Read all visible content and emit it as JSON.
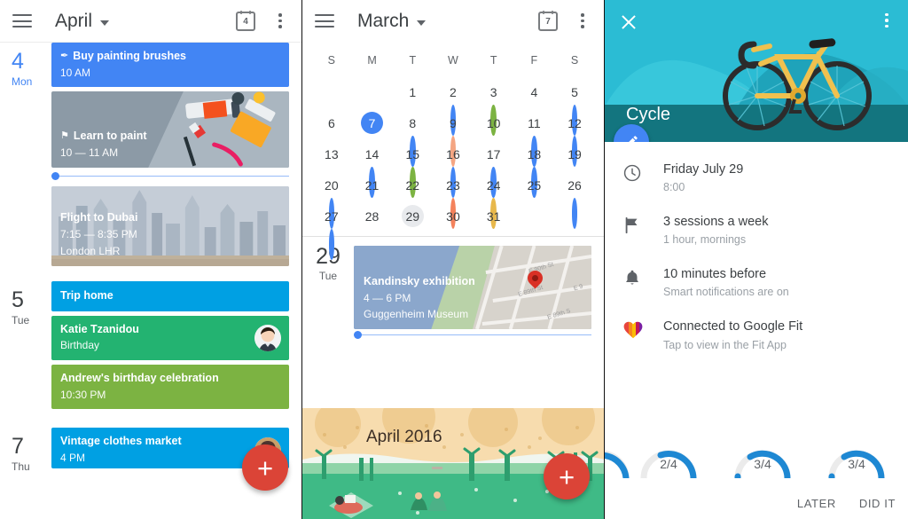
{
  "schedule_panel": {
    "toolbar": {
      "menu_icon": "hamburger-menu-icon",
      "title": "April",
      "dropdown_icon": "caret-down-icon",
      "calendar_icon_label": "4",
      "overflow_icon": "more-vertical-icon"
    },
    "days": [
      {
        "num": "4",
        "dow": "Mon",
        "is_today": true,
        "events": [
          {
            "title": "Buy painting brushes",
            "sub": "10 AM",
            "color": "#4285f4",
            "glyph": "✎",
            "style": "blue"
          },
          {
            "title": "Learn to paint",
            "sub": "10 — 11 AM",
            "glyph": "⚑",
            "style": "paint-image"
          },
          {
            "title": "Flight to Dubai",
            "sub": "7:15 — 8:35 PM",
            "sub2": "London LHR",
            "style": "dubai-image"
          }
        ]
      },
      {
        "num": "5",
        "dow": "Tue",
        "is_today": false,
        "events": [
          {
            "title": "Trip home",
            "sub": "",
            "color": "#00a0e3",
            "style": "lblue"
          },
          {
            "title": "Katie Tzanidou",
            "sub": "Birthday",
            "color": "#23b371",
            "style": "green",
            "avatar": true
          },
          {
            "title": "Andrew's birthday celebration",
            "sub": "10:30 PM",
            "color": "#7cb342",
            "style": "ltgreen"
          }
        ]
      },
      {
        "num": "7",
        "dow": "Thu",
        "is_today": false,
        "events": [
          {
            "title": "Vintage clothes market",
            "sub": "4 PM",
            "color": "#00a0e3",
            "style": "lblue",
            "avatar": true
          }
        ]
      }
    ],
    "fab": {
      "icon": "plus-icon",
      "color": "#db4437"
    }
  },
  "month_panel": {
    "toolbar": {
      "menu_icon": "hamburger-menu-icon",
      "title": "March",
      "dropdown_icon": "caret-down-icon",
      "calendar_icon_label": "7",
      "overflow_icon": "more-vertical-icon"
    },
    "dow_headers": [
      "S",
      "M",
      "T",
      "W",
      "T",
      "F",
      "S"
    ],
    "weeks": [
      [
        {
          "n": ""
        },
        {
          "n": ""
        },
        {
          "n": "1"
        },
        {
          "n": "2",
          "dot": "#4285f4"
        },
        {
          "n": "3",
          "dot": "#7cb342"
        },
        {
          "n": "4"
        },
        {
          "n": "5",
          "dot": "#4285f4"
        }
      ],
      [
        {
          "n": "6"
        },
        {
          "n": "7",
          "state": "sel"
        },
        {
          "n": "8",
          "dot": "#4285f4"
        },
        {
          "n": "9",
          "dot": "#f4a582"
        },
        {
          "n": "10"
        },
        {
          "n": "11",
          "dot": "#4285f4"
        },
        {
          "n": "12",
          "dot": "#4285f4"
        }
      ],
      [
        {
          "n": "13"
        },
        {
          "n": "14",
          "dot": "#4285f4"
        },
        {
          "n": "15",
          "dot": "#7cb342"
        },
        {
          "n": "16",
          "dot": "#4285f4"
        },
        {
          "n": "17",
          "dot": "#4285f4"
        },
        {
          "n": "18",
          "dot": "#4285f4"
        },
        {
          "n": "19"
        }
      ],
      [
        {
          "n": "20",
          "dot": "#4285f4"
        },
        {
          "n": "21"
        },
        {
          "n": "22"
        },
        {
          "n": "23",
          "dot": "#f4825c"
        },
        {
          "n": "24",
          "dot": "#e8b84b"
        },
        {
          "n": "25"
        },
        {
          "n": "26",
          "dot": "#4285f4"
        }
      ],
      [
        {
          "n": "27",
          "dot": "#4285f4"
        },
        {
          "n": "28"
        },
        {
          "n": "29",
          "state": "mut"
        },
        {
          "n": "30"
        },
        {
          "n": "31"
        },
        {
          "n": ""
        },
        {
          "n": ""
        }
      ]
    ],
    "agenda": {
      "day_num": "29",
      "day_dow": "Tue",
      "event": {
        "title": "Kandinsky exhibition",
        "time": "4 — 6 PM",
        "location": "Guggenheim Museum",
        "map_pin_icon": "map-pin-icon",
        "streets": [
          "E 90th St",
          "E 89th St",
          "E 9",
          "E 89th S"
        ]
      }
    },
    "illustration_label": "April 2016",
    "fab": {
      "icon": "plus-icon",
      "color": "#db4437"
    }
  },
  "goal_panel": {
    "close_icon": "close-icon",
    "overflow_icon": "more-vertical-icon",
    "hero_title": "Cycle",
    "hero_illustration": "bicycle-illustration",
    "edit_fab_icon": "pencil-icon",
    "rows": [
      {
        "icon": "clock-icon",
        "title": "Friday July 29",
        "sub": "8:00"
      },
      {
        "icon": "flag-icon",
        "title": "3 sessions a week",
        "sub": "1 hour, mornings"
      },
      {
        "icon": "bell-icon",
        "title": "10 minutes before",
        "sub": "Smart notifications are on"
      },
      {
        "icon": "heart-icon",
        "title": "Connected to Google Fit",
        "sub": "Tap to view in the Fit App"
      }
    ],
    "progress_rings": [
      {
        "label": "",
        "done": 3,
        "total": 4,
        "partial_left": true
      },
      {
        "label": "2/4",
        "done": 2,
        "total": 4
      },
      {
        "label": "3/4",
        "done": 3,
        "total": 4
      },
      {
        "label": "3/4",
        "done": 3,
        "total": 4
      }
    ],
    "actions": {
      "later": "LATER",
      "did_it": "DID IT"
    },
    "accent_color": "#1e88d3"
  }
}
